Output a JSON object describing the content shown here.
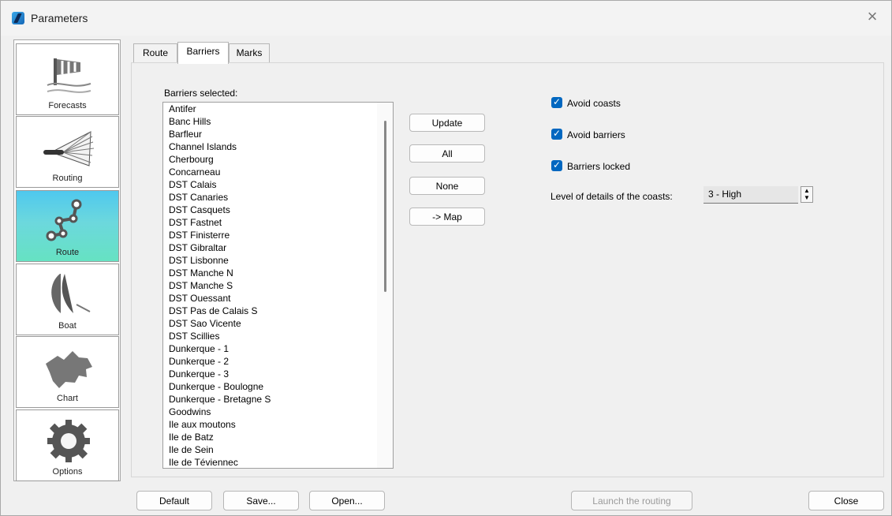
{
  "window": {
    "title": "Parameters",
    "close_icon": "close-icon"
  },
  "sidebar": {
    "items": [
      {
        "label": "Forecasts",
        "icon": "windsock-icon"
      },
      {
        "label": "Routing",
        "icon": "fan-icon"
      },
      {
        "label": "Route",
        "icon": "route-icon"
      },
      {
        "label": "Boat",
        "icon": "sail-icon"
      },
      {
        "label": "Chart",
        "icon": "map-icon"
      },
      {
        "label": "Options",
        "icon": "gear-icon"
      }
    ]
  },
  "tabs": [
    {
      "label": "Route"
    },
    {
      "label": "Barriers"
    },
    {
      "label": "Marks"
    }
  ],
  "barriers": {
    "label": "Barriers selected:",
    "items": [
      "Antifer",
      "Banc Hills",
      "Barfleur",
      "Channel Islands",
      "Cherbourg",
      "Concarneau",
      "DST Calais",
      "DST Canaries",
      "DST Casquets",
      "DST Fastnet",
      "DST Finisterre",
      "DST Gibraltar",
      "DST Lisbonne",
      "DST Manche N",
      "DST Manche S",
      "DST Ouessant",
      "DST Pas de Calais S",
      "DST Sao Vicente",
      "DST Scillies",
      "Dunkerque - 1",
      "Dunkerque - 2",
      "Dunkerque - 3",
      "Dunkerque - Boulogne",
      "Dunkerque - Bretagne S",
      "Goodwins",
      "Ile aux moutons",
      "Ile de Batz",
      "Ile de Sein",
      "Ile de Téviennec"
    ]
  },
  "actions": {
    "update": "Update",
    "all": "All",
    "none": "None",
    "map": "-> Map"
  },
  "options": {
    "avoid_coasts": "Avoid coasts",
    "avoid_barriers": "Avoid barriers",
    "barriers_locked": "Barriers locked",
    "coast_detail_label": "Level of details of the coasts:",
    "coast_detail_value": "3 - High"
  },
  "footer": {
    "default": "Default",
    "save": "Save...",
    "open": "Open...",
    "launch": "Launch the routing",
    "close": "Close"
  }
}
